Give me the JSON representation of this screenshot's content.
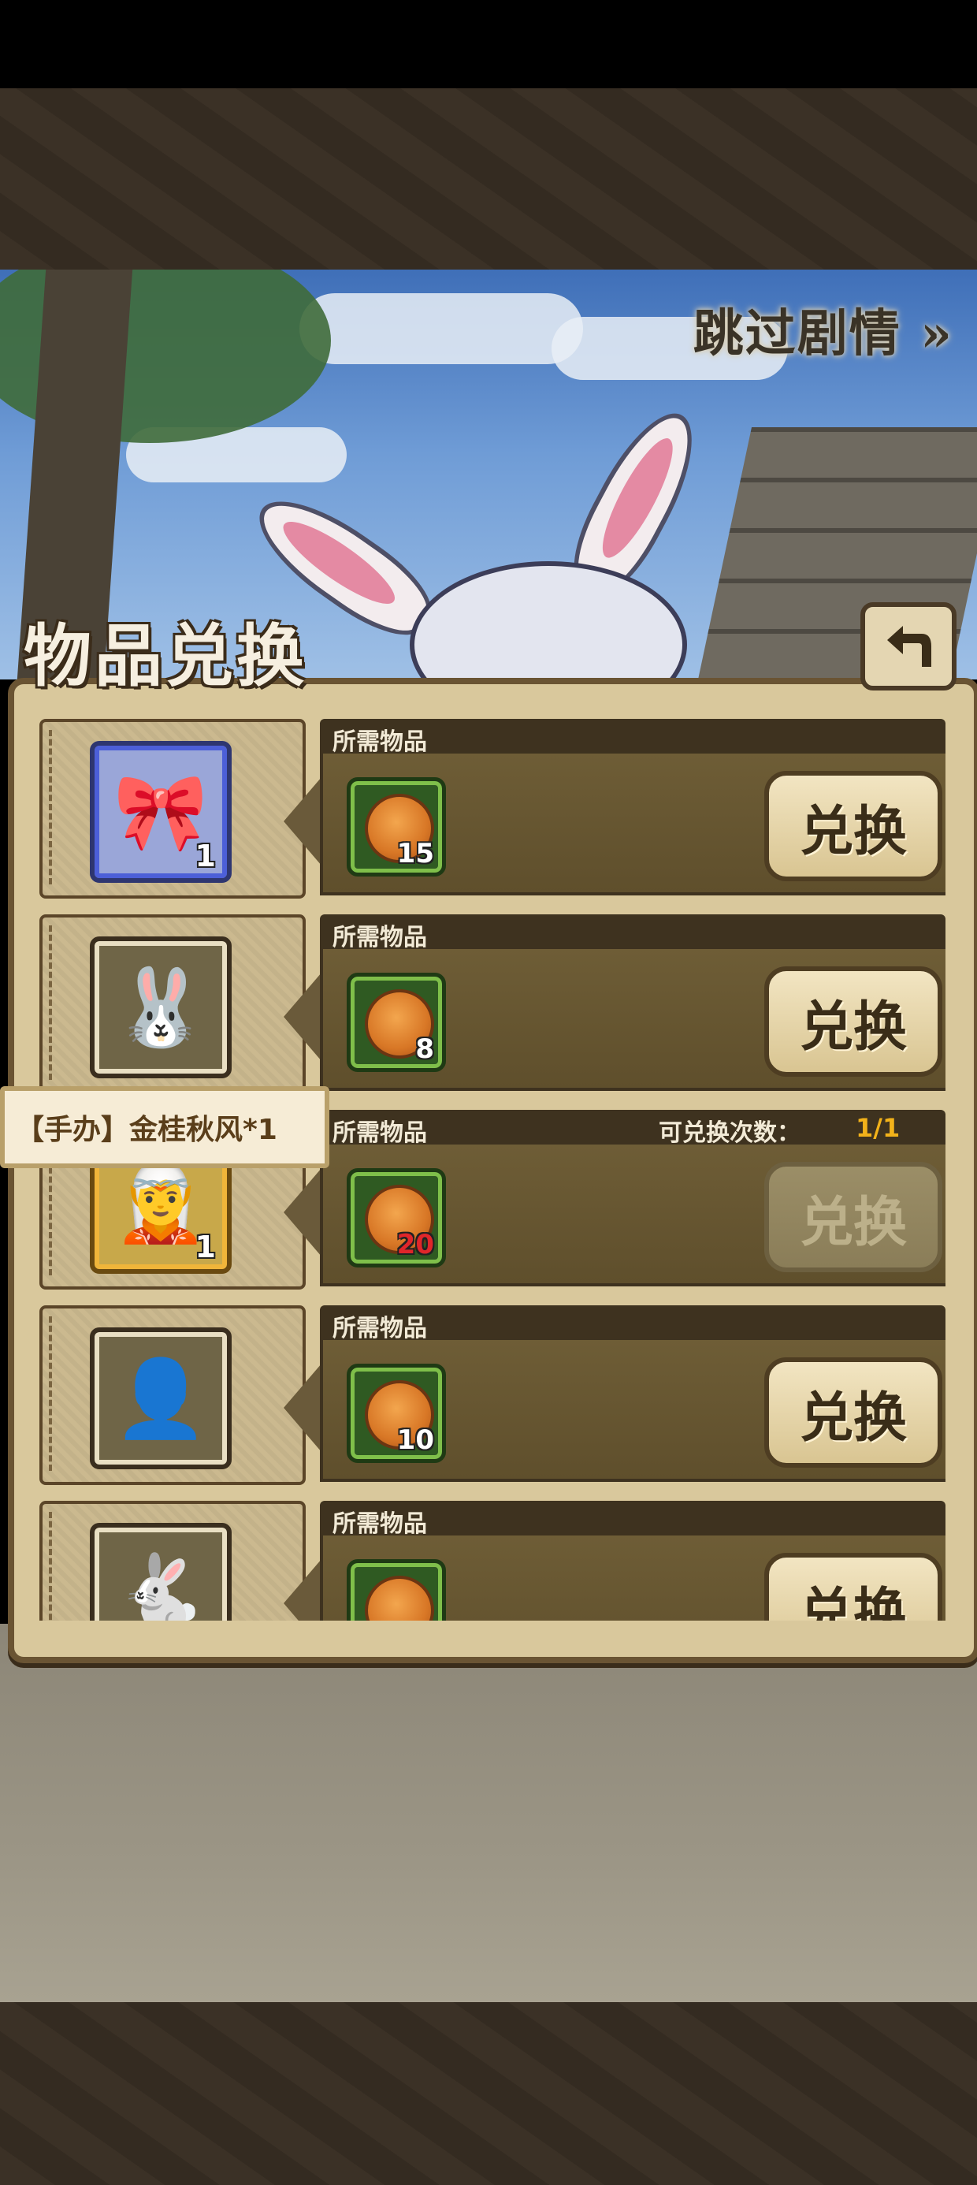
{
  "header": {
    "skip_label": "跳过剧情",
    "skip_arrow": "»"
  },
  "panel": {
    "title": "物品兑换",
    "back_icon": "return-arrow-icon"
  },
  "tooltip": {
    "text": "【手办】金桂秋风*1"
  },
  "rows": [
    {
      "item_icon": "rabbit-bundle-icon",
      "item_glyph": "🎀",
      "item_count": "1",
      "req_label": "所需物品",
      "limit_label": "",
      "limit_value": "",
      "cost_icon": "mooncake-icon",
      "cost": "15",
      "cost_insufficient": false,
      "button_label": "兑换",
      "enabled": true
    },
    {
      "item_icon": "bunny-ears-headband-icon",
      "item_glyph": "🐰",
      "item_count": "",
      "req_label": "所需物品",
      "limit_label": "",
      "limit_value": "",
      "cost_icon": "mooncake-icon",
      "cost": "8",
      "cost_insufficient": false,
      "button_label": "兑换",
      "enabled": true
    },
    {
      "item_icon": "figurine-icon",
      "item_glyph": "🧝",
      "item_count": "1",
      "req_label": "所需物品",
      "limit_label": "可兑换次数：",
      "limit_value": "1/1",
      "cost_icon": "mooncake-icon",
      "cost": "20",
      "cost_insufficient": true,
      "button_label": "兑换",
      "enabled": false
    },
    {
      "item_icon": "small-character-icon",
      "item_glyph": "👤",
      "item_count": "",
      "req_label": "所需物品",
      "limit_label": "",
      "limit_value": "",
      "cost_icon": "mooncake-icon",
      "cost": "10",
      "cost_insufficient": false,
      "button_label": "兑换",
      "enabled": true
    },
    {
      "item_icon": "rabbit-ear-item-icon",
      "item_glyph": "🐇",
      "item_count": "",
      "req_label": "所需物品",
      "limit_label": "",
      "limit_value": "",
      "cost_icon": "mooncake-icon",
      "cost": "",
      "cost_insufficient": false,
      "button_label": "兑换",
      "enabled": true
    }
  ]
}
